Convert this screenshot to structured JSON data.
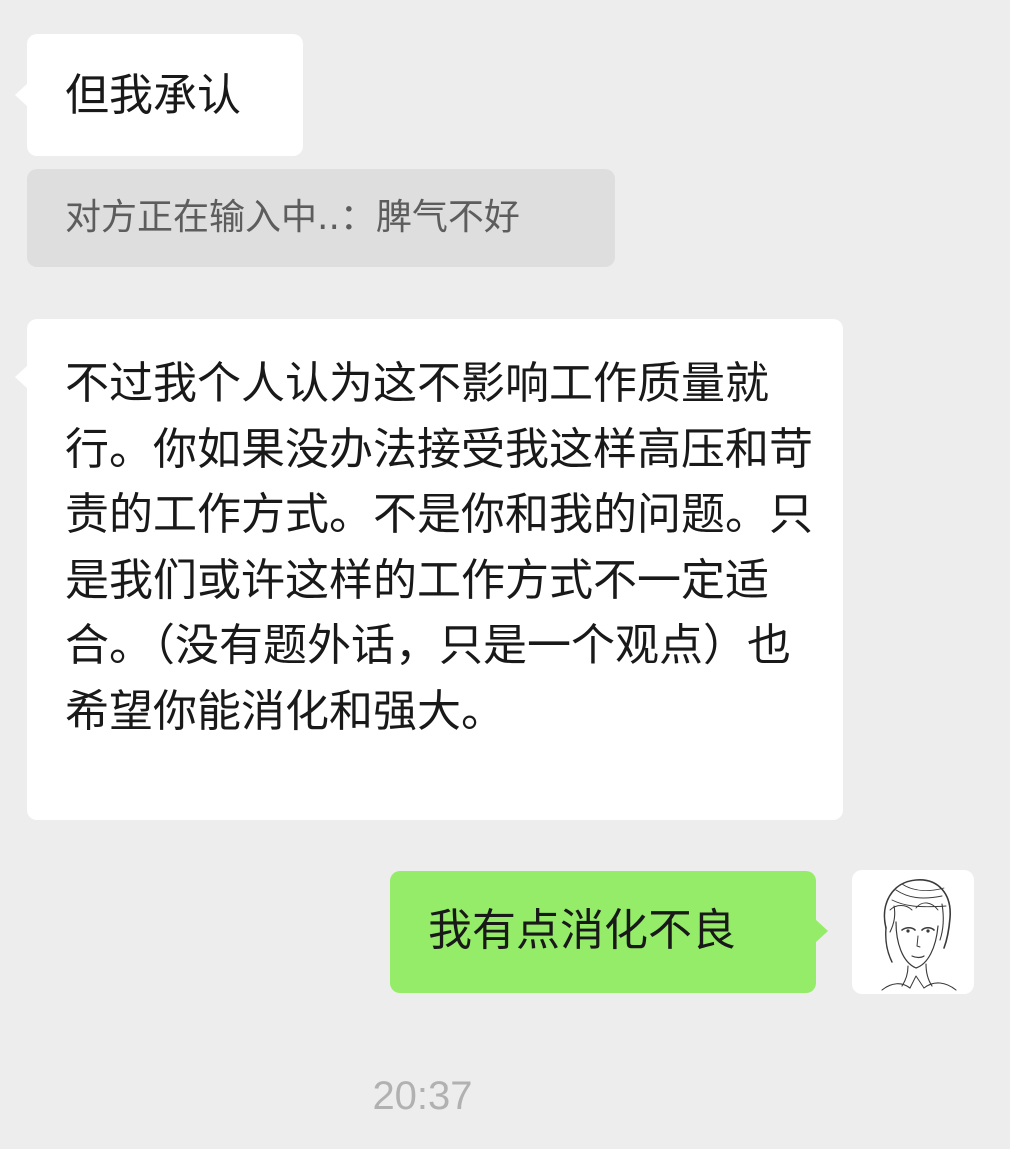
{
  "messages": [
    {
      "direction": "incoming",
      "text": "但我承认"
    },
    {
      "direction": "incoming",
      "text": "不过我个人认为这不影响工作质量就行。你如果没办法接受我这样高压和苛责的工作方式。不是你和我的问题。只是我们或许这样的工作方式不一定适合。（没有题外话，只是一个观点）也希望你能消化和强大。"
    },
    {
      "direction": "outgoing",
      "text": "我有点消化不良"
    }
  ],
  "quote": {
    "text": "对方正在输入中..：脾气不好"
  },
  "timestamp": "20:37",
  "colors": {
    "background": "#ededed",
    "incoming_bubble": "#ffffff",
    "outgoing_bubble": "#95ec69",
    "quote_bubble": "#dedede"
  },
  "icons": {
    "avatar": "sketch-portrait-avatar"
  }
}
